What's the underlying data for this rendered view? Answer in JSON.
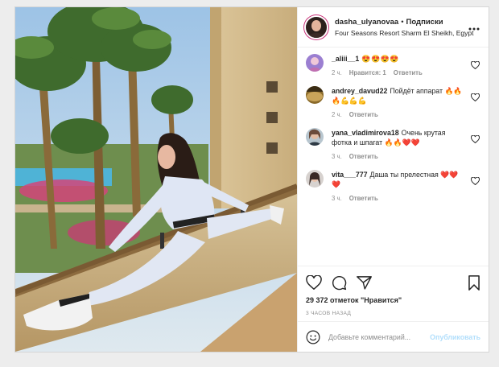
{
  "header": {
    "username": "dasha_ulyanovaa",
    "separator": "•",
    "follow_label": "Подписки",
    "location": "Four Seasons Resort Sharm El Sheikh, Egypt",
    "more_icon": "more-horizontal-icon"
  },
  "comments": [
    {
      "username": "_aliii__1",
      "text": "😍😍😍😍",
      "time": "2 ч.",
      "likes": "Нравится: 1",
      "reply": "Ответить",
      "avatar_color": "#9b7fd1"
    },
    {
      "username": "andrey_davud22",
      "text": "Пойдёт аппарат 🔥🔥🔥💪💪💪",
      "time": "2 ч.",
      "likes": "",
      "reply": "Ответить",
      "avatar_color": "#8a6a2a"
    },
    {
      "username": "yana_vladimirova18",
      "text": "Очень крутая фотка и шпагат 🔥🔥❤️❤️",
      "time": "3 ч.",
      "likes": "",
      "reply": "Ответить",
      "avatar_color": "#6f8796"
    },
    {
      "username": "vita___777",
      "text": "Даша ты прелестная ❤️❤️❤️",
      "time": "3 ч.",
      "likes": "",
      "reply": "Ответить",
      "avatar_color": "#5c4a44"
    }
  ],
  "actions": {
    "likes_text": "29 372 отметок \"Нравится\"",
    "time_ago": "3 ЧАСОВ НАЗАД"
  },
  "add_comment": {
    "placeholder": "Добавьте комментарий...",
    "publish_label": "Опубликовать"
  },
  "colors": {
    "text": "#262626",
    "muted": "#8e8e8e",
    "publish_disabled": "#b2dffc",
    "story_ring": "#c9337a"
  }
}
